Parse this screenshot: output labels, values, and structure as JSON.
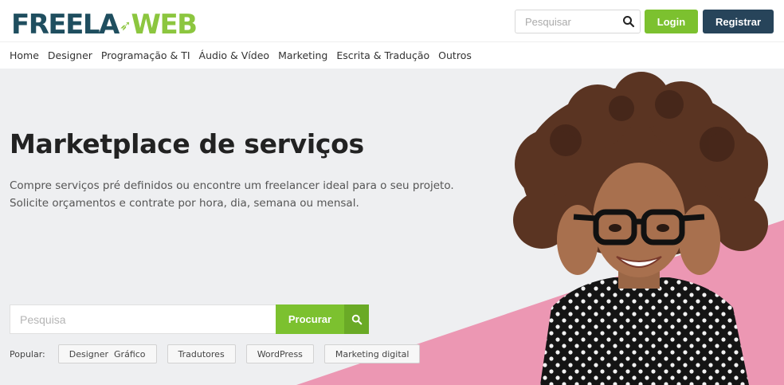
{
  "header": {
    "logo_part1": "FREELA",
    "logo_part2": "WEB",
    "search_placeholder": "Pesquisar",
    "login_label": "Login",
    "register_label": "Registrar"
  },
  "nav": {
    "items": [
      {
        "label": "Home"
      },
      {
        "label": "Designer"
      },
      {
        "label": "Programação & TI"
      },
      {
        "label": "Áudio & Vídeo"
      },
      {
        "label": "Marketing"
      },
      {
        "label": "Escrita & Tradução"
      },
      {
        "label": "Outros"
      }
    ]
  },
  "hero": {
    "title": "Marketplace de serviços",
    "subtitle": "Compre serviços pré definidos ou encontre um freelancer ideal para o seu projeto. Solicite orçamentos e contrate por hora, dia, semana ou mensal.",
    "search_placeholder": "Pesquisa",
    "search_button": "Procurar",
    "popular_label": "Popular:",
    "popular_tags": [
      {
        "label": "Designer  Gráfico"
      },
      {
        "label": "Tradutores"
      },
      {
        "label": "WordPress"
      },
      {
        "label": "Marketing digital"
      }
    ]
  },
  "colors": {
    "brand_dark": "#27445a",
    "brand_green": "#7cc12f",
    "hero_bg": "#eeeff1",
    "pink": "#ec97b3"
  },
  "icons": {
    "top_search": "search-icon",
    "main_search": "search-icon"
  }
}
